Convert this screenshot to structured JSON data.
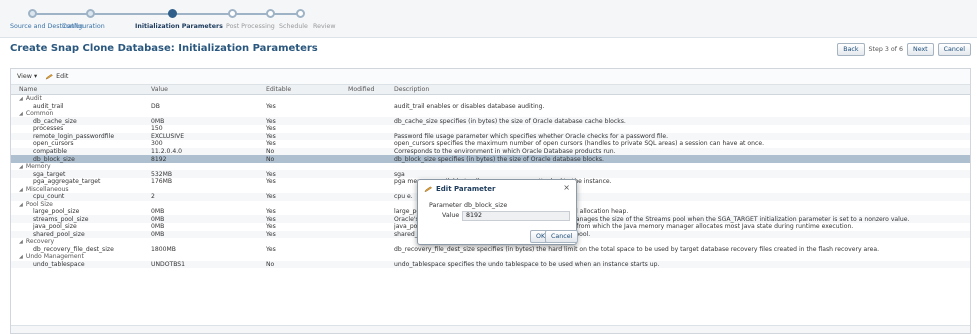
{
  "train": {
    "steps": [
      {
        "label": "Source and Destination",
        "state": "done"
      },
      {
        "label": "Configuration",
        "state": "done"
      },
      {
        "label": "Initialization Parameters",
        "state": "current"
      },
      {
        "label": "Post Processing",
        "state": "future"
      },
      {
        "label": "Schedule",
        "state": "future"
      },
      {
        "label": "Review",
        "state": "future"
      }
    ]
  },
  "header": {
    "title": "Create Snap Clone Database: Initialization Parameters",
    "back_label": "Back",
    "step_text": "Step 3 of 6",
    "next_label": "Next",
    "cancel_label": "Cancel"
  },
  "toolbar": {
    "view_label": "View ▾",
    "edit_label": "Edit"
  },
  "table": {
    "columns": {
      "name": "Name",
      "value": "Value",
      "editable": "Editable",
      "modified": "Modified",
      "description": "Description"
    },
    "rows": [
      {
        "kind": "group",
        "name": "Audit"
      },
      {
        "kind": "param",
        "name": "audit_trail",
        "value": "DB",
        "editable": "Yes",
        "modified": "",
        "description": "audit_trail enables or disables database auditing."
      },
      {
        "kind": "group",
        "name": "Common"
      },
      {
        "kind": "param",
        "name": "db_cache_size",
        "value": "0MB",
        "editable": "Yes",
        "modified": "",
        "description": "db_cache_size specifies (in bytes) the size of Oracle database cache blocks."
      },
      {
        "kind": "param",
        "name": "processes",
        "value": "150",
        "editable": "Yes",
        "modified": "",
        "description": ""
      },
      {
        "kind": "param",
        "name": "remote_login_passwordfile",
        "value": "EXCLUSIVE",
        "editable": "Yes",
        "modified": "",
        "description": "Password file usage parameter which specifies whether Oracle checks for a password file."
      },
      {
        "kind": "param",
        "name": "open_cursors",
        "value": "300",
        "editable": "Yes",
        "modified": "",
        "description": "open_cursors specifies the maximum number of open cursors (handles to private SQL areas) a session can have at once."
      },
      {
        "kind": "param",
        "name": "compatible",
        "value": "11.2.0.4.0",
        "editable": "No",
        "modified": "",
        "description": "Corresponds to the environment in which Oracle Database products run."
      },
      {
        "kind": "param",
        "name": "db_block_size",
        "value": "8192",
        "editable": "No",
        "modified": "",
        "description": "db_block_size specifies (in bytes) the size of Oracle database blocks.",
        "selected": true
      },
      {
        "kind": "group",
        "name": "Memory"
      },
      {
        "kind": "param",
        "name": "sga_target",
        "value": "532MB",
        "editable": "Yes",
        "modified": "",
        "description": "sga"
      },
      {
        "kind": "param",
        "name": "pga_aggregate_target",
        "value": "176MB",
        "editable": "Yes",
        "modified": "",
        "description": "pga                                                                                     memory available to all server processes attached to the instance."
      },
      {
        "kind": "group",
        "name": "Miscellaneous"
      },
      {
        "kind": "param",
        "name": "cpu_count",
        "value": "2",
        "editable": "Yes",
        "modified": "",
        "description": "cpu                                                                                     e."
      },
      {
        "kind": "group",
        "name": "Pool Size"
      },
      {
        "kind": "param",
        "name": "large_pool_size",
        "value": "0MB",
        "editable": "Yes",
        "modified": "",
        "description": "large_pool_size specifies (in bytes) the size of the large pool allocation heap."
      },
      {
        "kind": "param",
        "name": "streams_pool_size",
        "value": "0MB",
        "editable": "Yes",
        "modified": "",
        "description": "Oracle's Automatic Shared Memory Management feature manages the size of the Streams pool when the SGA_TARGET initialization parameter is set to a nonzero value."
      },
      {
        "kind": "param",
        "name": "java_pool_size",
        "value": "0MB",
        "editable": "Yes",
        "modified": "",
        "description": "java_pool_size specifies (in bytes) the size of the Java pool, from which the Java memory manager allocates most Java state during runtime execution."
      },
      {
        "kind": "param",
        "name": "shared_pool_size",
        "value": "0MB",
        "editable": "Yes",
        "modified": "",
        "description": "shared_pool_size specifies (in bytes) the size of the shared pool."
      },
      {
        "kind": "group",
        "name": "Recovery"
      },
      {
        "kind": "param",
        "name": "db_recovery_file_dest_size",
        "value": "1800MB",
        "editable": "Yes",
        "modified": "",
        "description": "db_recovery_file_dest_size specifies (in bytes) the hard limit on the total space to be used by target database recovery files created in the flash recovery area."
      },
      {
        "kind": "group",
        "name": "Undo Management"
      },
      {
        "kind": "param",
        "name": "undo_tablespace",
        "value": "UNDOTBS1",
        "editable": "No",
        "modified": "",
        "description": "undo_tablespace specifies the undo tablespace to be used when an instance starts up."
      }
    ]
  },
  "dialog": {
    "title": "Edit Parameter",
    "close_glyph": "×",
    "parameter_label": "Parameter",
    "parameter_value": "db_block_size",
    "value_label": "Value",
    "value_value": "8192",
    "ok_label": "OK",
    "cancel_label": "Cancel"
  },
  "colors": {
    "accent": "#2a577e",
    "selected_row": "#aebfcf"
  }
}
